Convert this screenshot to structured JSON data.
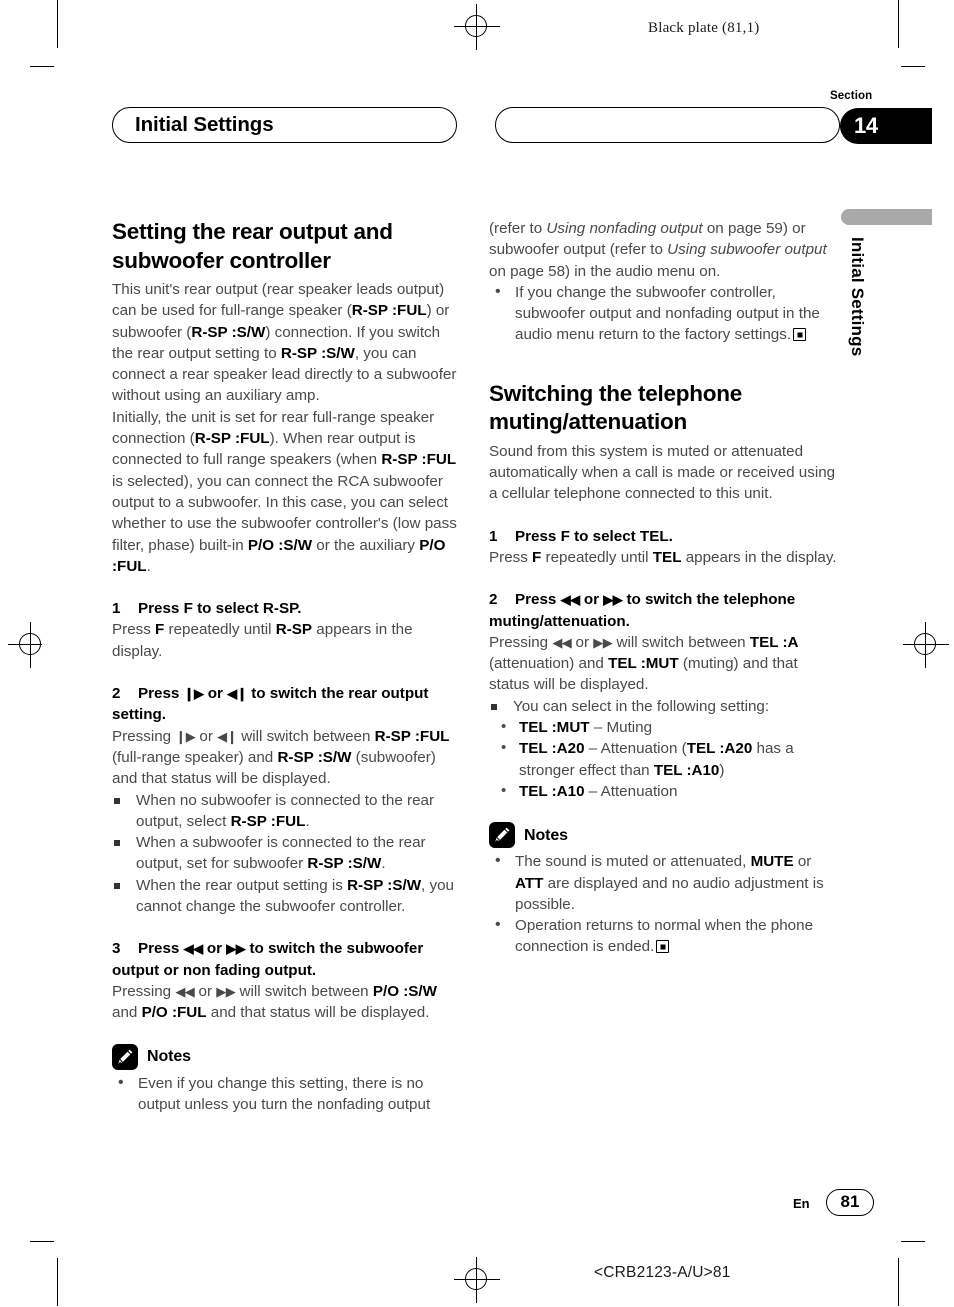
{
  "page": {
    "running_head": "Black plate (81,1)",
    "section_word": "Section",
    "section_number": "14",
    "chapter_pill": "Initial Settings",
    "side_tab_label": "Initial Settings",
    "footer_lang": "En",
    "footer_page": "81",
    "footer_code": "<CRB2123-A/U>81"
  },
  "left": {
    "heading": "Setting the rear output and subwoofer controller",
    "intro1_a": "This unit's rear output (rear speaker leads output) can be used for full-range speaker (",
    "intro1_b": "R-SP :FUL",
    "intro1_c": ") or subwoofer (",
    "intro1_d": "R-SP :S/W",
    "intro1_e": ") connection. If you switch the rear output setting to ",
    "intro1_f": "R-SP :S/W",
    "intro1_g": ", you can connect a rear speaker lead directly to a subwoofer without using an auxiliary amp.",
    "intro2_a": "Initially, the unit is set for rear full-range speaker connection (",
    "intro2_b": "R-SP :FUL",
    "intro2_c": "). When rear output is connected to full range speakers (when ",
    "intro2_d": "R-SP :FUL",
    "intro2_e": " is selected), you can connect the RCA subwoofer output to a subwoofer. In this case, you can select whether to use the subwoofer controller's (low pass filter, phase) built-in ",
    "intro2_f": "P/O  :S/W",
    "intro2_g": " or the auxiliary ",
    "intro2_h": "P/O  :FUL",
    "intro2_i": ".",
    "step1_num": "1",
    "step1_title": "Press F to select R-SP.",
    "step1_body_a": "Press ",
    "step1_body_b": "F",
    "step1_body_c": " repeatedly until ",
    "step1_body_d": "R-SP",
    "step1_body_e": " appears in the display.",
    "step2_num": "2",
    "step2_title_a": "Press ",
    "step2_title_g1": "❙▶",
    "step2_title_b": " or ",
    "step2_title_g2": "◀❙",
    "step2_title_c": " to switch the rear output setting.",
    "step2_body_a": "Pressing ",
    "step2_body_g1": "❙▶",
    "step2_body_b": " or ",
    "step2_body_g2": "◀❙",
    "step2_body_c": " will switch between ",
    "step2_body_d": "R-SP :FUL",
    "step2_body_e": " (full-range speaker) and ",
    "step2_body_f": "R-SP :S/W",
    "step2_body_g": " (subwoofer) and that status will be displayed.",
    "sq1_a": "When no subwoofer is connected to the rear output, select ",
    "sq1_b": "R-SP :FUL",
    "sq1_c": ".",
    "sq2_a": "When a subwoofer is connected to the rear output, set for subwoofer ",
    "sq2_b": "R-SP :S/W",
    "sq2_c": ".",
    "sq3_a": "When the rear output setting is ",
    "sq3_b": "R-SP :S/W",
    "sq3_c": ", you cannot change the subwoofer controller.",
    "step3_num": "3",
    "step3_title_a": "Press ",
    "step3_title_g1": "◀◀",
    "step3_title_b": " or ",
    "step3_title_g2": "▶▶",
    "step3_title_c": " to switch the subwoofer output or non fading output.",
    "step3_body_a": "Pressing ",
    "step3_body_g1": "◀◀",
    "step3_body_b": " or ",
    "step3_body_g2": "▶▶",
    "step3_body_c": " will switch between ",
    "step3_body_d": "P/O  :S/W",
    "step3_body_e": " and ",
    "step3_body_f": "P/O  :FUL",
    "step3_body_g": " and that status will be displayed.",
    "notes_title": "Notes",
    "note1": "Even if you change this setting, there is no output unless you turn the nonfading output"
  },
  "right": {
    "cont_a": "(refer to ",
    "cont_i1": "Using nonfading output",
    "cont_b": " on page 59) or subwoofer output (refer to ",
    "cont_i2": "Using subwoofer output",
    "cont_c": " on page 58) in the audio menu on.",
    "note_cont": "If you change the subwoofer controller, subwoofer output and nonfading output in the audio menu return to the factory settings.",
    "heading": "Switching the telephone muting/attenuation",
    "intro": "Sound from this system is muted or attenuated automatically when a call is made or received using a cellular telephone connected to this unit.",
    "step1_num": "1",
    "step1_title": "Press F to select TEL.",
    "step1_body_a": "Press ",
    "step1_body_b": "F",
    "step1_body_c": " repeatedly until ",
    "step1_body_d": "TEL",
    "step1_body_e": " appears in the display.",
    "step2_num": "2",
    "step2_title_a": "Press ",
    "step2_title_g1": "◀◀",
    "step2_title_b": " or ",
    "step2_title_g2": "▶▶",
    "step2_title_c": " to switch the telephone muting/attenuation.",
    "step2_body_a": "Pressing ",
    "step2_body_g1": "◀◀",
    "step2_body_b": " or ",
    "step2_body_g2": "▶▶",
    "step2_body_c": " will switch between ",
    "step2_body_d": "TEL :A",
    "step2_body_e": " (attenuation) and ",
    "step2_body_f": "TEL :MUT",
    "step2_body_g": " (muting) and that status will be displayed.",
    "sq1": "You can select in the following setting:",
    "opt1_b": "TEL :MUT",
    "opt1_t": " – Muting",
    "opt2_b": "TEL :A20",
    "opt2_t1": " – Attenuation (",
    "opt2_b2": "TEL :A20",
    "opt2_t2": " has a stronger effect than ",
    "opt2_b3": "TEL :A10",
    "opt2_t3": ")",
    "opt3_b": "TEL :A10",
    "opt3_t": " – Attenuation",
    "notes_title": "Notes",
    "note1_a": "The sound is muted or attenuated, ",
    "note1_b": "MUTE",
    "note1_c": " or ",
    "note1_d": "ATT",
    "note1_e": " are displayed and no audio adjustment is possible.",
    "note2": "Operation returns to normal when the phone connection is ended."
  }
}
